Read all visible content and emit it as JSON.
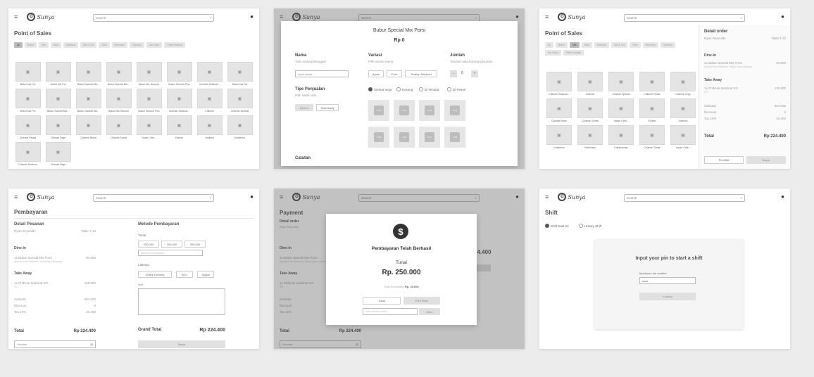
{
  "common": {
    "search_placeholder": "Search",
    "search_icon": "search-icon",
    "bell_icon": "bell-icon",
    "menu_icon": "menu-icon",
    "logo_text": "Sunya",
    "logo_letter": "G"
  },
  "pos": {
    "title": "Point of Sales",
    "chips": [
      "All",
      "Bubur",
      "Mie",
      "Nasi",
      "Seafood",
      "Mie & Ghi",
      "Soto",
      "Minuman",
      "Cemilan",
      "Ala Carte",
      "Paket Spesial"
    ],
    "items": [
      "Bubur Nol Pol",
      "Bubur Mix Pol",
      "Bubur Special Mix...",
      "Bubur Special Mix...",
      "Bubur Mix Seluruh",
      "Bubur Seluruh Plus",
      "Chikmie Seafood...",
      "Bubur Nol Pol",
      "Bubur Mix Pol",
      "Bubur Special Mix...",
      "Bubur Special Mix...",
      "Bubur Mix Seluruh",
      "Bubur Seluruh Plus",
      "Chikmie Seafood...",
      "Chikmie",
      "Chikmie Spesial",
      "Chikmie Pedas",
      "Chikmie Vege",
      "Chikmie Bixen",
      "Chikmie Tomat",
      "Yamie / Mie...",
      "Kolmie",
      "Yokiblus",
      "Kollalmun",
      "Chikmie Seafood",
      "Chikmie Vege"
    ]
  },
  "variant": {
    "title": "Bubur Special Mix Porsi",
    "price": "Rp 0",
    "nama_label": "Nama",
    "nama_sub": "Tulis nama pelanggan",
    "nama_placeholder": "Input nama",
    "variasi_label": "Variasi",
    "variasi_sub": "Pilih variasi menu",
    "variasi_opts": [
      "Ayam",
      "Pork",
      "Scallop Seafood"
    ],
    "jumlah_label": "Jumlah",
    "jumlah_sub": "Tambah atau kurangi pesanan",
    "jumlah_value": "0",
    "tipe_label": "Tipe Penjualan",
    "tipe_sub": "Pilih salah satu",
    "tipe_opts": [
      "Dine In",
      "Take Away"
    ],
    "meja_opts": [
      "Semua meja",
      "Kosong",
      "Di Tempat",
      "Di Pesan"
    ],
    "tables": [
      "T-01",
      "T-02",
      "T-03",
      "T-04",
      "T-05",
      "T-06",
      "T-07",
      "T-08"
    ],
    "catatan_label": "Catatan"
  },
  "detail": {
    "title": "Point of Sales",
    "chips": [
      "All",
      "Bubur",
      "Mie",
      "Nasi",
      "Seafood",
      "Mie & Ghi",
      "Soto",
      "Minuman",
      "Cemilan",
      "Ala Carte",
      "Paket Spesial"
    ],
    "items": [
      "Chikmie Seafood...",
      "Chikmie",
      "Chikmie Spesial",
      "Chikmie Pedas",
      "Chikmie Vege",
      "Chikmie Bixen",
      "Chikmie Tomat",
      "Yamie / Mie...",
      "Kolmie",
      "Yokiblus",
      "Kollalmun",
      "Yokiblusau",
      "Kollalmudau",
      "Chikmie Tomat",
      "Yamie / Mie..."
    ],
    "order_title": "Detail order",
    "customer": "Ryan Reynolds",
    "table": "Table T-12",
    "dine_in": "Dine-In",
    "dine_item": "1x Bubur Special Mix Porsi",
    "dine_note": "Special Pork Seafood, Tanpa Daun Bawang",
    "dine_price": "84.000",
    "take_away": "Take Away",
    "take_item": "1x Chikmie Seafood XO",
    "take_note": "XO",
    "take_price": "120.000",
    "subtotal_label": "Subtotal",
    "subtotal": "204.000",
    "discount_label": "Discount",
    "discount": "0",
    "tax_label": "Tax 10%",
    "tax": "20.400",
    "total_label": "Total",
    "total": "Rp 224.400",
    "print_btn": "Print Bill",
    "pay_btn": "Bayar"
  },
  "payment": {
    "title": "Pembayaran",
    "detail_title": "Detail Pesanan",
    "customer": "Ryan Reynolds",
    "table": "Table T-12",
    "dine_in": "Dine-In",
    "dine_item": "1x Bubur Special Mix Porsi",
    "dine_note": "Special Pork Seafood, Tanpa Daun Bawang",
    "dine_price": "84.000",
    "take_away": "Take Away",
    "take_item": "1x Chikmie Seafood XO",
    "take_note": "XO",
    "take_price": "120.000",
    "subtotal_label": "Subtotal",
    "subtotal": "204.000",
    "discount_label": "Discount",
    "discount": "0",
    "tax_label": "Tax 10%",
    "tax": "20.400",
    "total_label": "Total",
    "total": "Rp 224.400",
    "voucher": "Voucher",
    "method_title": "Metode Pembayaran",
    "tunai": "Tunai",
    "amounts": [
      "230.000",
      "250.000",
      "300.000"
    ],
    "amount_placeholder": "Nominal pembayaran",
    "lainnya": "Lainnya",
    "other_methods": [
      "Online Delivery",
      "EDC",
      "Digital"
    ],
    "note_label": "Note",
    "grand_label": "Grand Total",
    "grand_total": "Rp 224.400",
    "pay_btn": "Bayar"
  },
  "success": {
    "title": "Payment",
    "detail_title": "Detail order",
    "customer": "Ryan Reynolds",
    "dine_in": "Dine-In",
    "dine_item": "1x Bubur Special Mix Porsi",
    "dine_note": "Special Pork Seafood, Tanpa Daun Bawang",
    "take_away": "Take Away",
    "take_item": "1x Chikmie Seafood XO",
    "take_note": "XO",
    "subtotal_label": "Subtotal",
    "discount_label": "Discount",
    "tax_label": "Tax 10%",
    "total_label": "Total",
    "total": "Rp 224.400",
    "voucher": "Voucher",
    "bg_amount": "24.400",
    "dollar_icon": "dollar-icon",
    "heading": "Pembayaran Telah Berhasil",
    "method": "Tunai",
    "amount": "Rp. 250.000",
    "kembalian_label": "Total Kembalian",
    "kembalian": "Rp. 25.600",
    "tutup_btn": "Tutup",
    "print_btn": "Print Struk",
    "email_placeholder": "Kirim struk ke email",
    "kirim_btn": "Kirim"
  },
  "shift": {
    "title": "Shift",
    "radio_opts": [
      "Shift Saat Ini",
      "History Shift"
    ],
    "heading": "Input your pin to start a shift",
    "pin_label": "Input your pin number",
    "pin_value": "••••••",
    "confirm_btn": "Confirm"
  }
}
